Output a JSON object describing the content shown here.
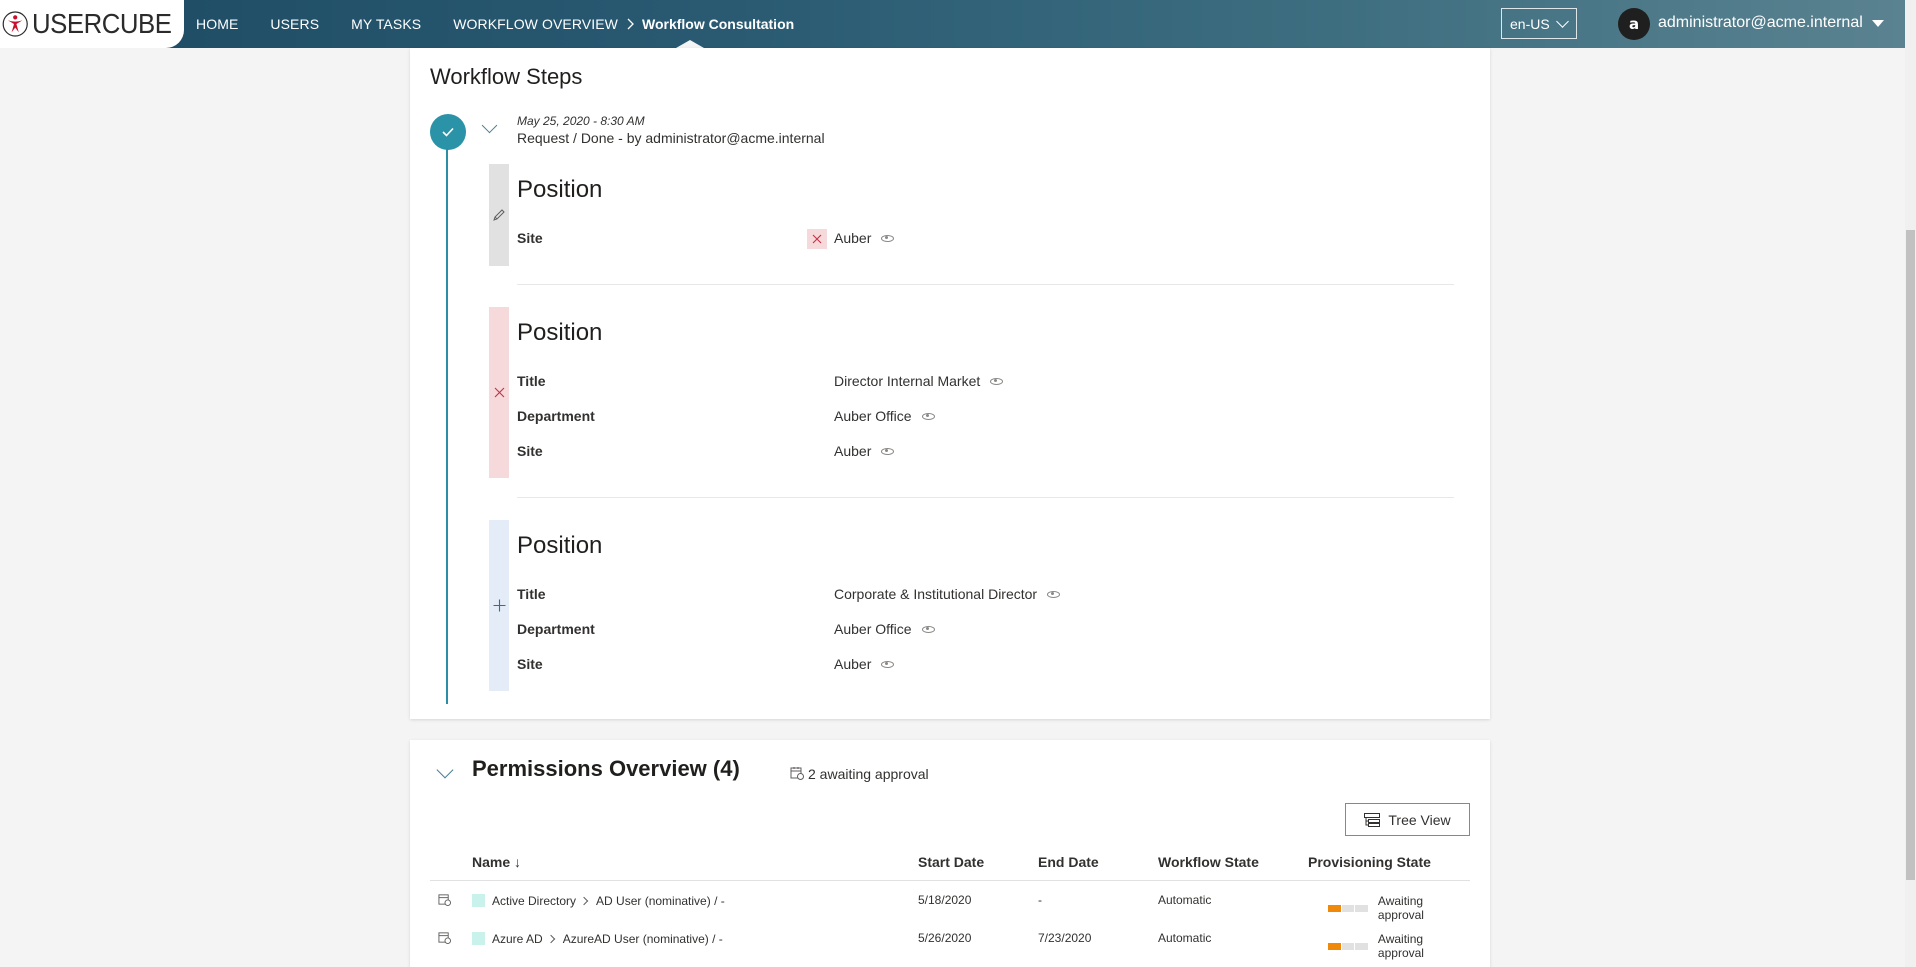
{
  "app": {
    "logo_text": "USERCUBE"
  },
  "nav": {
    "items": [
      "HOME",
      "USERS",
      "MY TASKS",
      "WORKFLOW OVERVIEW"
    ],
    "current": "Workflow Consultation"
  },
  "header": {
    "language": "en-US",
    "avatar_initial": "a",
    "user": "administrator@acme.internal"
  },
  "workflow_steps": {
    "title": "Workflow Steps",
    "step": {
      "date": "May 25, 2020  - 8:30 AM",
      "summary": "Request / Done - by administrator@acme.internal",
      "status_icon": "checkmark-icon"
    },
    "blocks": [
      {
        "change": "edit",
        "icon": "pencil-icon",
        "title": "Position",
        "fields": [
          {
            "label": "Site",
            "value": "Auber",
            "removed_badge": true
          }
        ]
      },
      {
        "change": "delete",
        "icon": "close-icon",
        "title": "Position",
        "fields": [
          {
            "label": "Title",
            "value": "Director Internal Market"
          },
          {
            "label": "Department",
            "value": "Auber Office"
          },
          {
            "label": "Site",
            "value": "Auber"
          }
        ]
      },
      {
        "change": "add",
        "icon": "plus-icon",
        "title": "Position",
        "fields": [
          {
            "label": "Title",
            "value": "Corporate & Institutional Director"
          },
          {
            "label": "Department",
            "value": "Auber Office"
          },
          {
            "label": "Site",
            "value": "Auber"
          }
        ]
      }
    ]
  },
  "permissions": {
    "title": "Permissions Overview (4)",
    "awaiting": "2 awaiting approval",
    "tree_view_label": "Tree View",
    "columns": [
      "Name ↓",
      "Start Date",
      "End Date",
      "Workflow State",
      "Provisioning State"
    ],
    "rows": [
      {
        "system": "Active Directory",
        "resource": "AD User (nominative) / -",
        "start": "5/18/2020",
        "end": "-",
        "workflow": "Automatic",
        "provisioning": "Awaiting approval",
        "progress_steps_done": 1,
        "progress_steps_total": 3
      },
      {
        "system": "Azure AD",
        "resource": "AzureAD User (nominative) / -",
        "start": "5/26/2020",
        "end": "7/23/2020",
        "workflow": "Automatic",
        "provisioning": "Awaiting approval",
        "progress_steps_done": 1,
        "progress_steps_total": 3
      }
    ]
  },
  "colors": {
    "accent": "#2a93a8",
    "delete_bg": "#f6d9da",
    "add_bg": "#e4ecf7",
    "edit_bg": "#e1e1e1",
    "progress_active": "#f0890a",
    "swatch": "#c9f2ec"
  }
}
